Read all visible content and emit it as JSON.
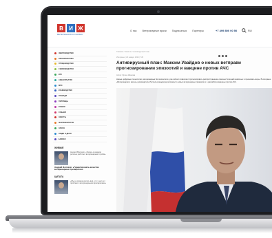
{
  "site": {
    "logo_letters": [
      "В",
      "И",
      "Ж"
    ],
    "logo_colors": [
      "#d0342c",
      "#2e6fbf",
      "#d0342c"
    ],
    "logo_subtitle": "ВЕТЕРИНАРИЯ И ЖИЗНЬ"
  },
  "header": {
    "nav": [
      "О нас",
      "Ветеринарные врачи",
      "Подписаться",
      "Партнеры"
    ],
    "phone": "+7 499 800 00 50",
    "lang": "RU"
  },
  "sidebar": {
    "items": [
      {
        "label": "ЗВЕРОВОДСТВО",
        "color": "#d0342c"
      },
      {
        "label": "ПРОФИЛАКТИКА",
        "color": "#e87a2a"
      },
      {
        "label": "ПТИЦЕВОДСТВО",
        "color": "#e8b92a"
      },
      {
        "label": "СВИНОВОДСТВО",
        "color": "#8cc14a"
      },
      {
        "label": "КРС",
        "color": "#3aa85a"
      },
      {
        "label": "АКВАКУЛЬТУРА",
        "color": "#2aa8a0"
      },
      {
        "label": "МРС",
        "color": "#2a8ad0"
      },
      {
        "label": "КОНЕВОДСТВО",
        "color": "#2e5fbf"
      },
      {
        "label": "ЛОШАДИ",
        "color": "#5a4ac0"
      },
      {
        "label": "ПИТОМЦЫ",
        "color": "#8a3ac0"
      },
      {
        "label": "КОШКИ",
        "color": "#c03aa8"
      },
      {
        "label": "СОБАКИ",
        "color": "#d0346a"
      },
      {
        "label": "ЭКЗОТЫ",
        "color": "#d0342c"
      },
      {
        "label": "ФАРМАКОЛОГИЯ",
        "color": "#e87a2a"
      },
      {
        "label": "ЗАКОН",
        "color": "#3aa85a"
      },
      {
        "label": "ЛЮДИ И ДЕЛО",
        "color": "#2a8ad0"
      },
      {
        "label": "БИЗНЕС",
        "color": "#5a4ac0"
      }
    ],
    "section1": "ЖИВЫЕ",
    "card1_text": "Андрей Волохов: «Теперь в каждом регионе работает ветеринарная служба»",
    "card1_title": "Андрей Волохов: «Гарантировать качество ветеринарных препаратов»",
    "section2": "ЦИТАТА",
    "card2_text": "«Мы не можем делать вид, что у нас нет проблем с ветеринарными препаратами»",
    "card2_title": "«Мы не можем делать вид, что у нас нет проблем с ветеринарными препаратами»"
  },
  "article": {
    "breadcrumb": "Главная / Новости / Антивирусный план",
    "meta": "Интервью  | 23 января 2024  | 729",
    "title_line1": "Антивирусный план: Максим Увайдов о новых ветправи",
    "title_line2": "прогнозировании эпизоотий и вакцине против АЧС",
    "byline": "Автор: Ирина Иванова",
    "lead": "Новые цифровые технологии, ветеринарные биотехнологии, уже сейчас позволяют прогнозировать распространение опасных болезней животных и принимать меры. В интервью «Ветеринарии и жизни» руководитель Россельхознадзора рассказал о новых ветеринарных правилах и о разработке вакцины против АЧС."
  }
}
